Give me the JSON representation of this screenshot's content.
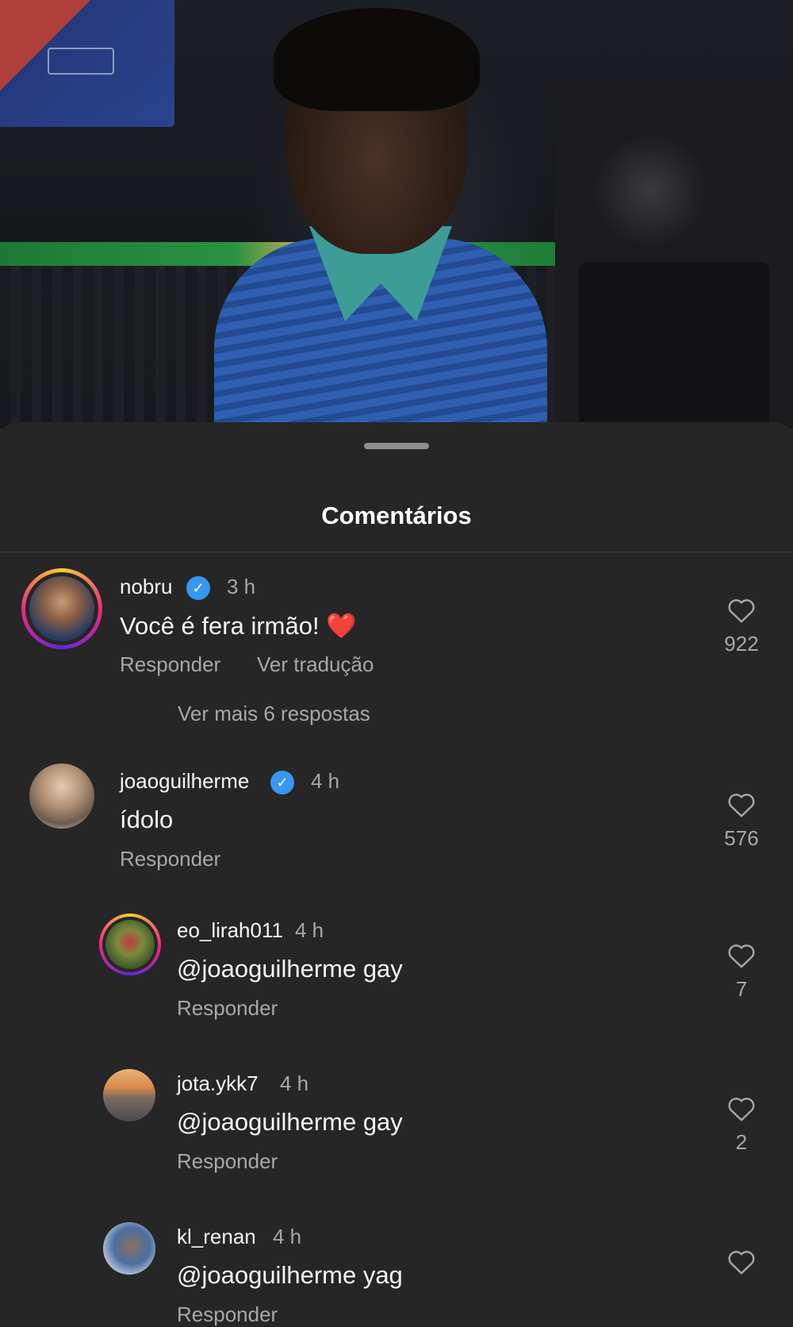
{
  "sheet": {
    "title": "Comentários"
  },
  "comments": [
    {
      "username": "nobru",
      "verified": true,
      "time": "3 h",
      "text": "Você é fera irmão!",
      "emoji": "❤️",
      "reply_label": "Responder",
      "translate_label": "Ver tradução",
      "more_replies_label": "Ver mais 6 respostas",
      "likes": "922",
      "avatar_icon": "profile-photo"
    },
    {
      "username": "joaoguilherme",
      "verified": true,
      "time": "4 h",
      "text": "ídolo",
      "reply_label": "Responder",
      "likes": "576",
      "avatar_icon": "profile-photo"
    }
  ],
  "replies": [
    {
      "username": "eo_lirah011",
      "time": "4 h",
      "text": "@joaoguilherme gay",
      "reply_label": "Responder",
      "likes": "7"
    },
    {
      "username": "jota.ykk7",
      "time": "4 h",
      "text": "@joaoguilherme gay",
      "reply_label": "Responder",
      "likes": "2"
    },
    {
      "username": "kl_renan",
      "time": "4 h",
      "text": "@joaoguilherme yag",
      "reply_label": "Responder",
      "likes": ""
    }
  ],
  "colors": {
    "background": "#262626",
    "secondary_text": "#a8a8a8",
    "verified_blue": "#3897f0",
    "heart_red": "#e0243a"
  }
}
